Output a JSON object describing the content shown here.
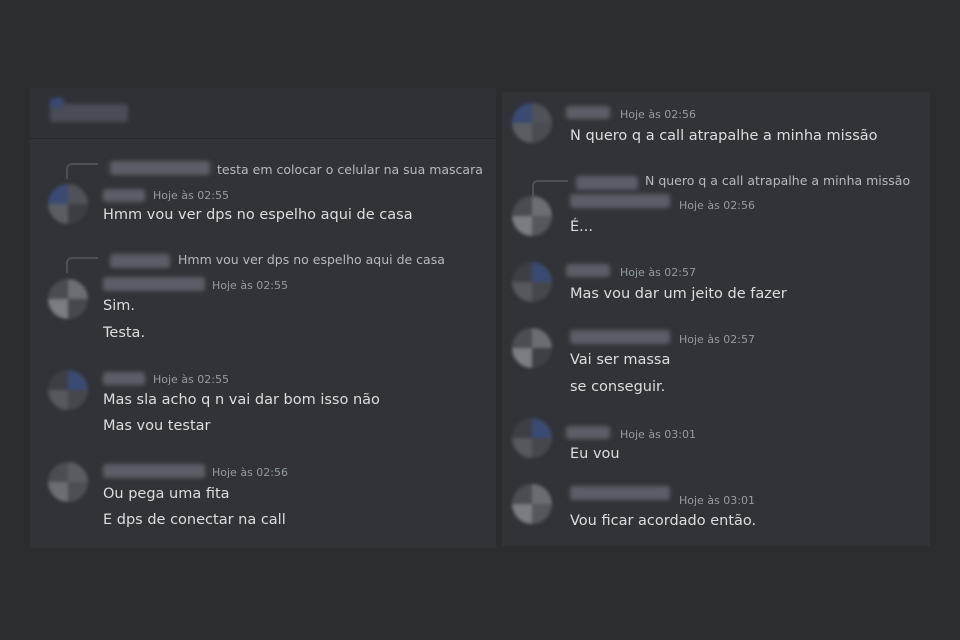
{
  "left_column": {
    "messages": [
      {
        "reply": "testa em colocar o celular na sua mascara",
        "time": "Hoje às 02:55",
        "lines": [
          "Hmm vou ver dps no espelho aqui de casa"
        ]
      },
      {
        "reply": "Hmm vou ver dps no espelho aqui de casa",
        "time": "Hoje às 02:55",
        "lines": [
          "Sim.",
          "Testa."
        ]
      },
      {
        "time": "Hoje às 02:55",
        "lines": [
          "Mas sla acho q n vai dar bom isso não",
          "Mas vou testar"
        ]
      },
      {
        "time": "Hoje às 02:56",
        "lines": [
          "Ou pega uma fita",
          "E dps de conectar na call"
        ]
      }
    ]
  },
  "right_column": {
    "messages": [
      {
        "time": "Hoje às 02:56",
        "lines": [
          "N quero q a call atrapalhe a minha missão"
        ]
      },
      {
        "reply": "N quero q a call atrapalhe a minha missão",
        "time": "Hoje às 02:56",
        "lines": [
          "É..."
        ]
      },
      {
        "time": "Hoje às 02:57",
        "lines": [
          "Mas vou dar um jeito de fazer"
        ]
      },
      {
        "time": "Hoje às 02:57",
        "lines": [
          "Vai ser massa",
          "se conseguir."
        ]
      },
      {
        "time": "Hoje às 03:01",
        "lines": [
          "Eu vou"
        ]
      },
      {
        "time": "Hoje às 03:01",
        "lines": [
          "Vou ficar acordado então."
        ]
      }
    ]
  },
  "colors": {
    "background": "#2b2d31",
    "panel": "#313338",
    "message_text": "#dbdee1",
    "timestamp": "#949ba4",
    "reply_text": "#b5bac1"
  }
}
